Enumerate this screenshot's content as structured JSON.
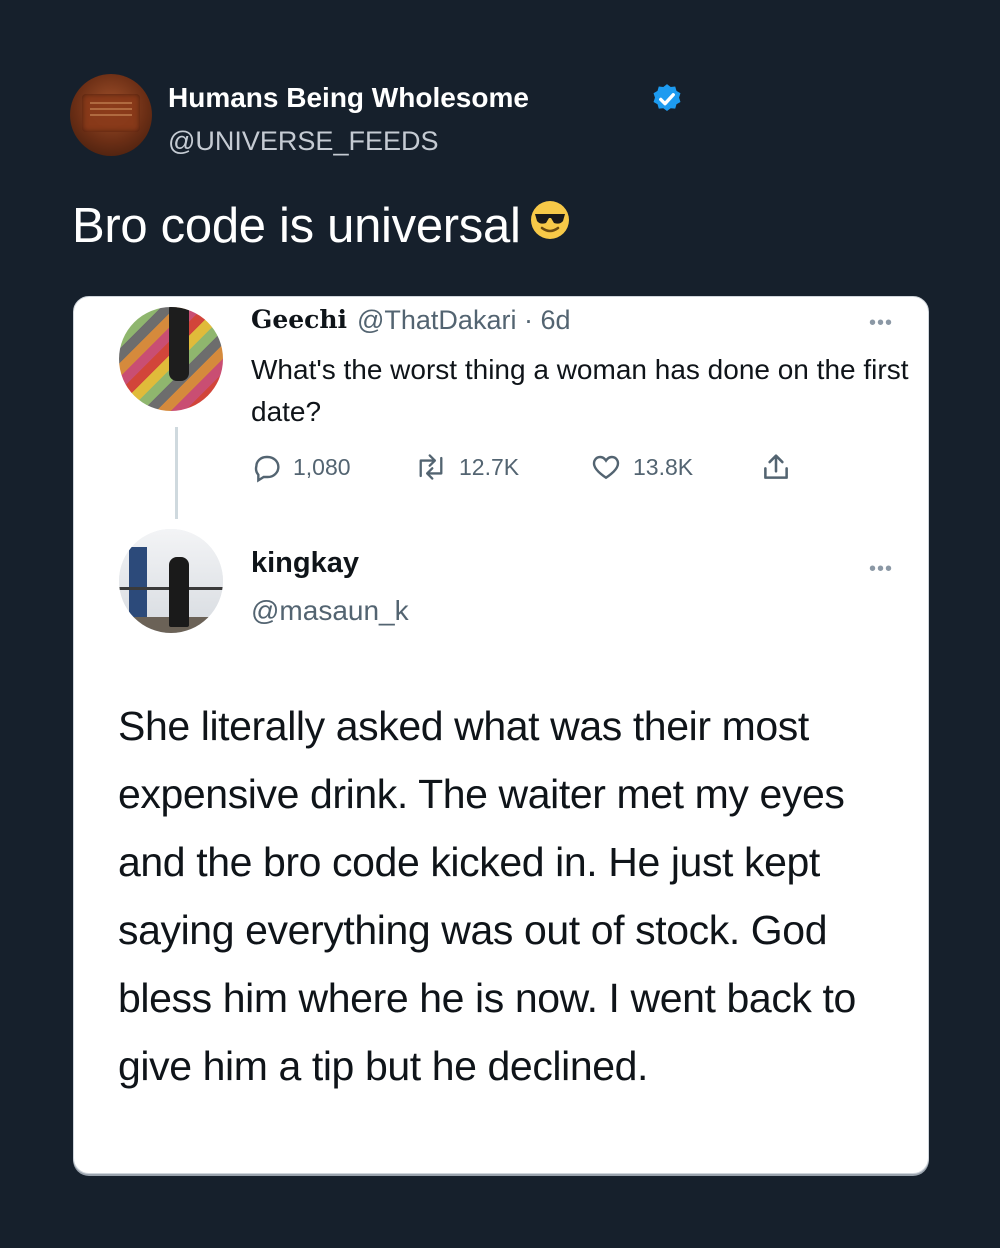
{
  "post": {
    "account_name": "Humans Being Wholesome",
    "account_handle": "@UNIVERSE_FEEDS",
    "text": "Bro code is universal",
    "emoji_icon": "smiling-face-with-sunglasses-icon"
  },
  "quoted_tweet": {
    "author_name": "Geechi",
    "author_handle": "@ThatDakari · 6d",
    "text": "What's the worst thing a woman has done on the first date?",
    "replies": "1,080",
    "retweets": "12.7K",
    "likes": "13.8K"
  },
  "reply": {
    "author_name": "kingkay",
    "author_handle": "@masaun_k",
    "text": "She literally asked what was their most expensive drink. The waiter met my eyes and the bro code kicked in. He just kept saying everything was out of stock. God bless him where he is now. I went back to give him a tip but he declined."
  },
  "colors": {
    "background": "#16202c",
    "verified": "#1d9bf0",
    "card": "#ffffff"
  }
}
